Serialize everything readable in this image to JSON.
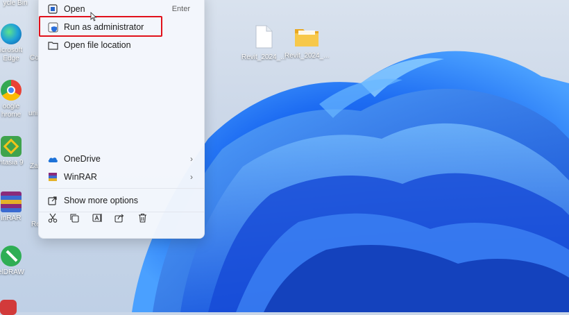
{
  "desktop": {
    "left_icons": [
      {
        "label": "ycle Bin",
        "color": "#3a7bd5"
      },
      {
        "label": "icrosoft\nEdge",
        "color": "#1fa0d8"
      },
      {
        "label": "oogle\nhrome",
        "color": "#e94235"
      },
      {
        "label": "ntasia 9",
        "color": "#3fa34d"
      },
      {
        "label": "inRAR",
        "color": "#8a2b7a"
      },
      {
        "label": "elDRAW",
        "color": "#2fae55"
      }
    ],
    "partial_labels": [
      "Co",
      "uni",
      "Zai",
      "Re"
    ],
    "files": [
      {
        "label": "Revit_2024_...",
        "type": "document"
      },
      {
        "label": "Revit_2024_...",
        "type": "folder"
      }
    ]
  },
  "context_menu": {
    "items": [
      {
        "label": "Open",
        "accelerator": "Enter",
        "icon": "open-icon"
      },
      {
        "label": "Run as administrator",
        "icon": "shield-icon"
      },
      {
        "label": "Open file location",
        "icon": "folder-icon"
      },
      {
        "label": "OneDrive",
        "icon": "onedrive-icon",
        "submenu": true
      },
      {
        "label": "WinRAR",
        "icon": "winrar-icon",
        "submenu": true
      },
      {
        "label": "Show more options",
        "icon": "show-more-icon"
      }
    ],
    "toolbar": [
      "cut-icon",
      "copy-icon",
      "rename-icon",
      "share-icon",
      "delete-icon"
    ],
    "highlight_color": "#e1101a"
  }
}
